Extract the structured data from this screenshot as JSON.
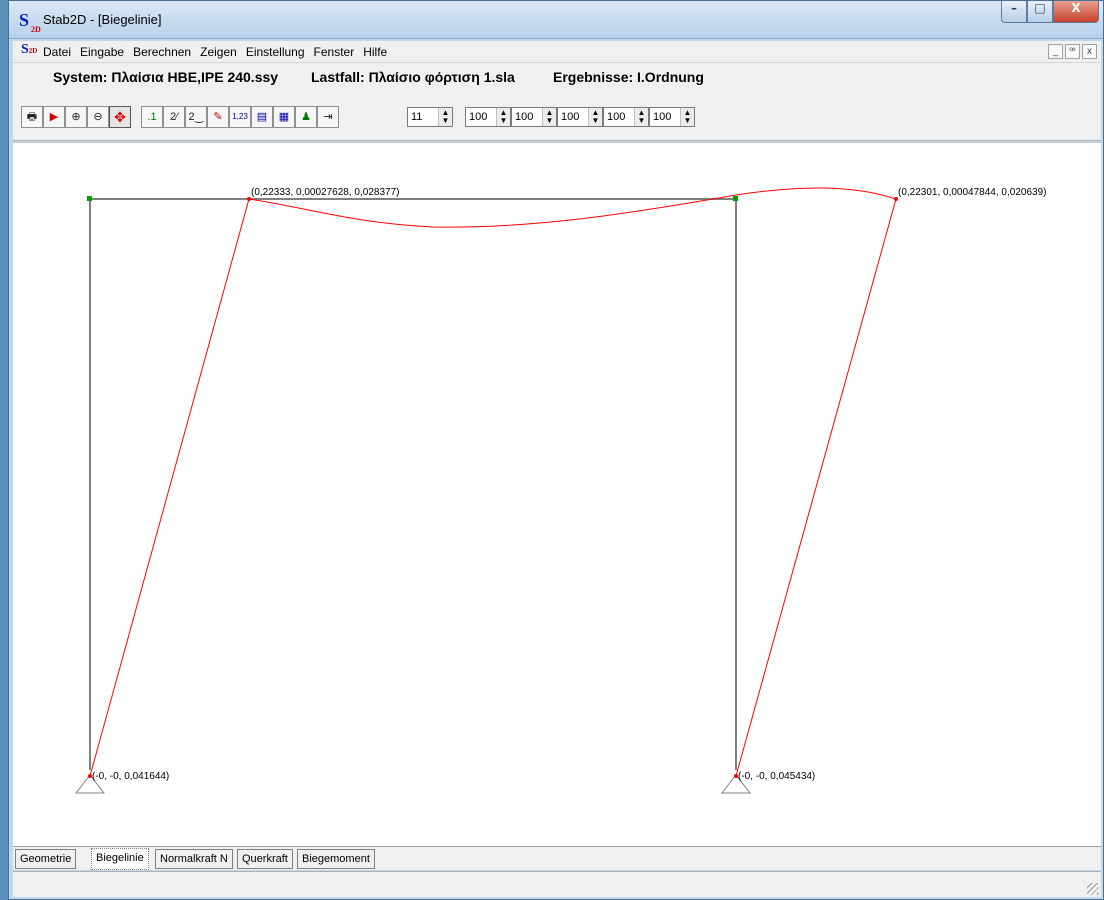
{
  "window": {
    "title": "Stab2D - [Biegelinie]",
    "logo": "S",
    "logo_sub": "2D"
  },
  "window_controls": {
    "minimize": "–",
    "maximize": "□",
    "close": "X"
  },
  "menu": {
    "items": [
      "Datei",
      "Eingabe",
      "Berechnen",
      "Zeigen",
      "Einstellung",
      "Fenster",
      "Hilfe"
    ],
    "mdi_controls": [
      "_",
      "ꟹ",
      "x"
    ]
  },
  "info": {
    "system": "System: Πλαίσια HBE,IPE 240.ssy",
    "lastfall": "Lastfall: Πλαίσιο φόρτιση 1.sla",
    "ergebnisse": "Ergebnisse: I.Ordnung"
  },
  "toolbar": {
    "icons": [
      "print-icon",
      "print-preview-icon",
      "zoom-in-icon",
      "zoom-out-icon",
      "pan-icon",
      "node-numbers-icon",
      "member-numbers-icon",
      "support-numbers-icon",
      "member-load-icon",
      "values-icon",
      "table-icon",
      "grid-icon",
      "result-person-icon",
      "export-icon"
    ],
    "glyphs": [
      "🖶",
      "▶",
      "⊕",
      "⊖",
      "✥",
      ".1",
      "2⁄",
      "2‿",
      "✎",
      "1,23",
      "▤",
      "▦",
      "♟",
      "⇥"
    ],
    "spinners": [
      "11",
      "100",
      "100",
      "100",
      "100",
      "100"
    ]
  },
  "drawing": {
    "labels": {
      "top_left": "(0,22333, 0,00027628, 0,028377)",
      "top_right": "(0,22301, 0,00047844, 0,020639)",
      "bottom_left": "(-0, -0, 0,041644)",
      "bottom_right": "(-0, -0, 0,045434)"
    },
    "colors": {
      "frame": "#808080",
      "deflection": "#ff0000",
      "node": "#00a000"
    }
  },
  "tabs": [
    "Geometrie",
    "Biegelinie",
    "Normalkraft N",
    "Querkraft",
    "Biegemoment"
  ],
  "active_tab": "Biegelinie",
  "status": {
    "text": ""
  }
}
